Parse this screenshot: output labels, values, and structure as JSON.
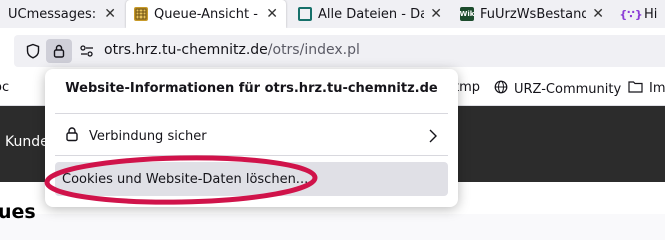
{
  "tabs": [
    {
      "label": "UCmessages: Cl",
      "icon": "tab-favicon-generic",
      "active": false
    },
    {
      "label": "Queue-Ansicht - T",
      "icon": "otrs-favicon",
      "active": true
    },
    {
      "label": "Alle Dateien - Dat",
      "icon": "file-favicon",
      "active": false
    },
    {
      "label": "FuUrzWsBestand",
      "icon": "wiki-favicon",
      "active": false
    },
    {
      "label": "Hig",
      "icon": "code-favicon",
      "active": false
    }
  ],
  "url": {
    "host": "otrs.hrz.tu-chemnitz.de",
    "path": "/otrs/index.pl"
  },
  "bookmarks": [
    {
      "label": "oc"
    },
    {
      "label": "tmp"
    },
    {
      "label": "URZ-Community"
    },
    {
      "label": "Im"
    }
  ],
  "page": {
    "kunde": "Kunde",
    "heading": "ues"
  },
  "site_info_panel": {
    "title": "Website-Informationen für otrs.hrz.tu-chemnitz.de",
    "connection_label": "Verbindung sicher",
    "cookies_button_label": "Cookies und Website-Daten löschen..."
  },
  "colors": {
    "annotation": "#d0134a",
    "page_header": "#2c2c2c"
  }
}
